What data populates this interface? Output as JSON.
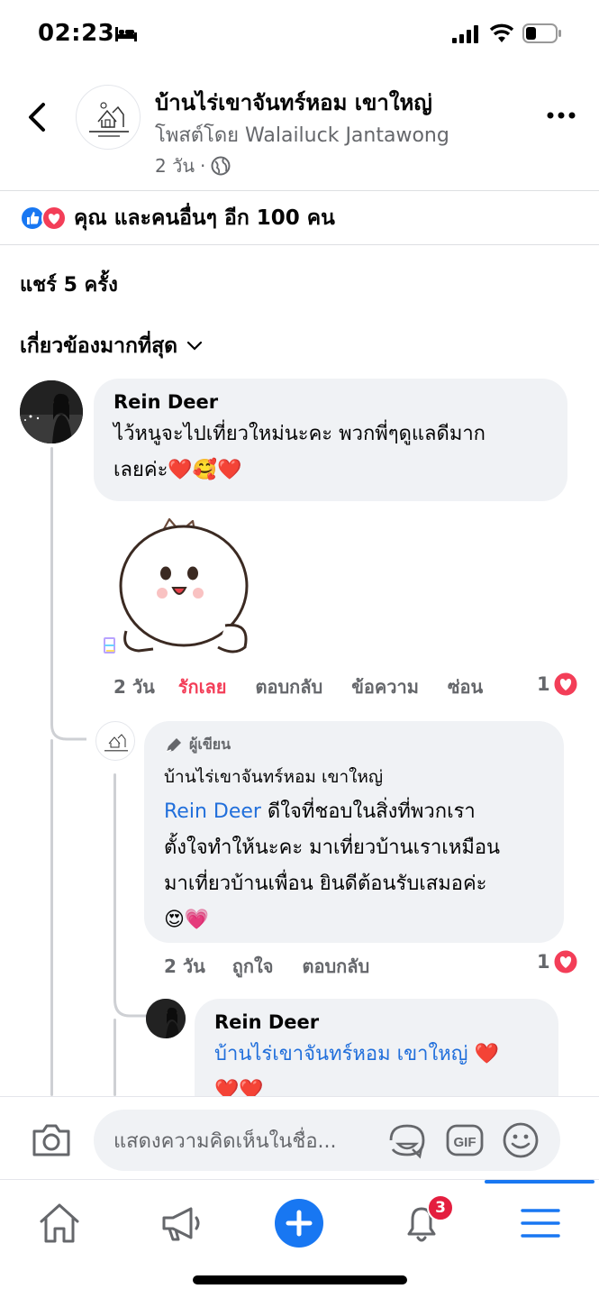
{
  "status": {
    "time": "02:23"
  },
  "header": {
    "page_name": "บ้านไร่เขาจันทร์หอม เขาใหญ่",
    "posted_by": "โพสต์โดย Walailuck Jantawong",
    "post_age": "2 วัน",
    "logo_text": "บ้านไร่เขาจันทร์หอม เขาใหญ่"
  },
  "reactions": {
    "summary": "คุณ และคนอื่นๆ อีก 100 คน"
  },
  "shares": "แชร์ 5 ครั้ง",
  "sort_label": "เกี่ยวข้องมากที่สุด",
  "comments": [
    {
      "author": "Rein Deer",
      "text_line1": "ไว้หนูจะไปเที่ยวใหม่นะคะ  พวกพี่ๆดูแลดีมาก",
      "text_line2": "เลยค่ะ❤️🥰❤️",
      "age": "2 วัน",
      "actions": [
        "รักเลย",
        "ตอบกลับ",
        "ข้อความ",
        "ซ่อน"
      ],
      "reaction_count": "1"
    },
    {
      "badge": "ผู้เขียน",
      "author": "บ้านไร่เขาจันทร์หอม เขาใหญ่",
      "mention": "Rein Deer",
      "line1_rest": " ดีใจที่ชอบในสิ่งที่พวกเรา",
      "line2": "ตั้งใจทำให้นะคะ มาเที่ยวบ้านเราเหมือน",
      "line3": "มาเที่ยวบ้านเพื่อน ยินดีต้อนรับเสมอค่ะ",
      "line4": "😍💗",
      "age": "2 วัน",
      "actions": [
        "ถูกใจ",
        "ตอบกลับ"
      ],
      "reaction_count": "1"
    },
    {
      "author": "Rein Deer",
      "mention": "บ้านไร่เขาจันทร์หอม เขาใหญ่",
      "hearts_inline": " ❤️",
      "line2": "❤️❤️"
    }
  ],
  "composer": {
    "placeholder": "แสดงความคิดเห็นในชื่อ..."
  },
  "tabbar": {
    "notification_count": "3"
  },
  "colors": {
    "accent": "#1877f2",
    "love": "#f33e58",
    "bubble": "#f0f2f5"
  }
}
